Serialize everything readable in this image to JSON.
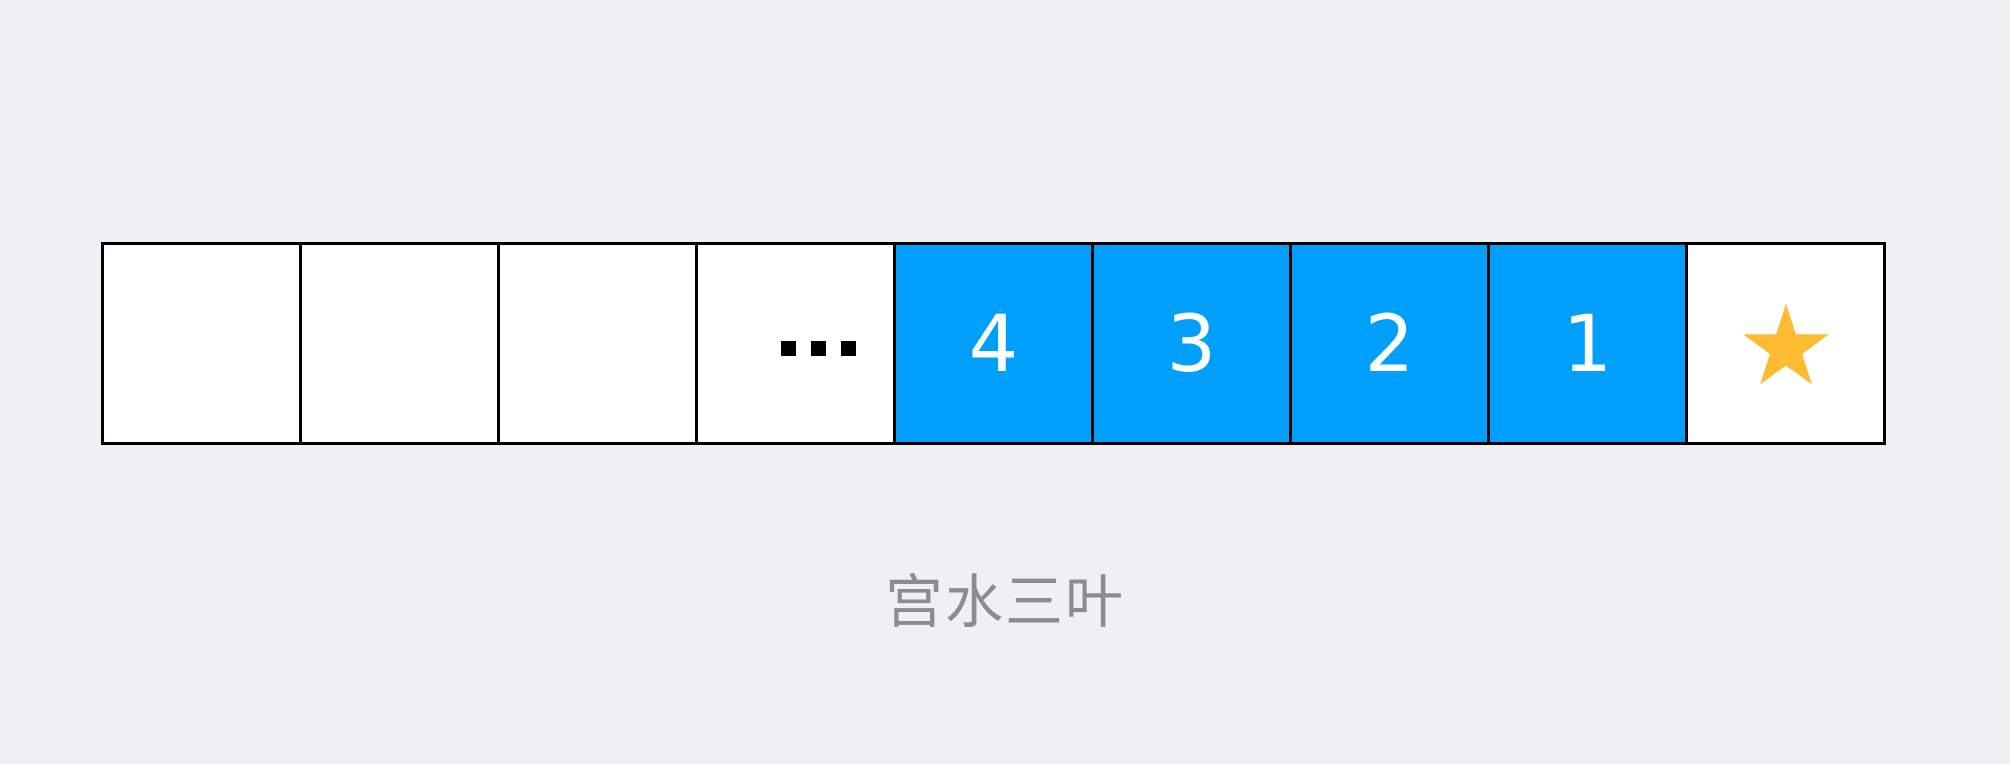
{
  "colors": {
    "background": "#efeff4",
    "empty_cell": "#ffffff",
    "filled_cell": "#009ffc",
    "cell_text": "#ffffff",
    "border": "#000000",
    "star": "#fcbb30",
    "caption": "#8c8c8c"
  },
  "cells": [
    {
      "label": "",
      "state": "empty"
    },
    {
      "label": "",
      "state": "empty"
    },
    {
      "label": "",
      "state": "empty"
    },
    {
      "label": "",
      "state": "ellipsis"
    },
    {
      "label": "4",
      "state": "filled"
    },
    {
      "label": "3",
      "state": "filled"
    },
    {
      "label": "2",
      "state": "filled"
    },
    {
      "label": "1",
      "state": "filled"
    },
    {
      "label": "",
      "state": "star",
      "icon": "star-icon"
    }
  ],
  "caption": "宫水三叶"
}
